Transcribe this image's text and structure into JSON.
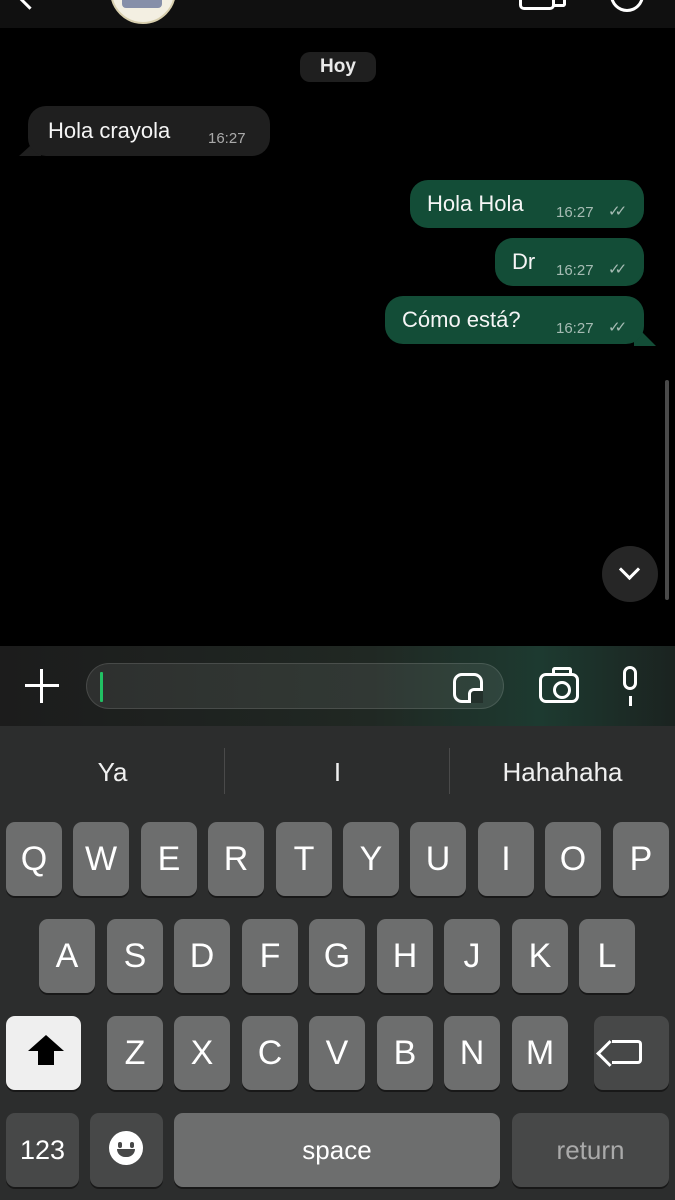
{
  "chat": {
    "date_pill": "Hoy",
    "messages": [
      {
        "direction": "in",
        "text": "Hola crayola",
        "time": "16:27"
      },
      {
        "direction": "out",
        "text": "Hola Hola",
        "time": "16:27",
        "status": "read"
      },
      {
        "direction": "out",
        "text": "Dr",
        "time": "16:27",
        "status": "read"
      },
      {
        "direction": "out",
        "text": "Cómo está?",
        "time": "16:27",
        "status": "read"
      }
    ]
  },
  "composer": {
    "placeholder": ""
  },
  "suggestions": [
    "Ya",
    "I",
    "Hahahaha"
  ],
  "keyboard": {
    "row1": [
      "Q",
      "W",
      "E",
      "R",
      "T",
      "Y",
      "U",
      "I",
      "O",
      "P"
    ],
    "row2": [
      "A",
      "S",
      "D",
      "F",
      "G",
      "H",
      "J",
      "K",
      "L"
    ],
    "row3": [
      "Z",
      "X",
      "C",
      "V",
      "B",
      "N",
      "M"
    ],
    "numbers_label": "123",
    "space_label": "space",
    "return_label": "return"
  },
  "colors": {
    "incoming_bubble": "#1f1f1f",
    "outgoing_bubble": "#134d37",
    "caret": "#21c063",
    "keyboard_bg": "#2c2d2d",
    "key": "#6d6e6e"
  }
}
